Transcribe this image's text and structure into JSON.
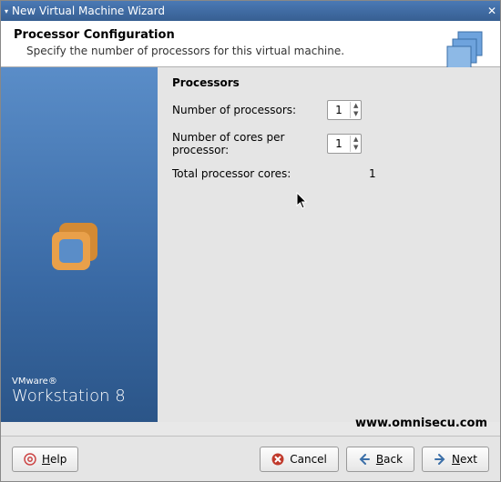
{
  "titlebar": {
    "text": "New Virtual Machine Wizard"
  },
  "header": {
    "title": "Processor Configuration",
    "subtitle": "Specify the number of processors for this virtual machine."
  },
  "sidebar": {
    "brand_small": "VMware®",
    "brand_big": "Workstation 8"
  },
  "processors": {
    "section": "Processors",
    "num_label": "Number of processors:",
    "num_value": "1",
    "cores_label": "Number of cores per processor:",
    "cores_value": "1",
    "total_label": "Total processor cores:",
    "total_value": "1"
  },
  "footer": {
    "url": "www.omnisecu.com"
  },
  "buttons": {
    "help": "Help",
    "cancel": "Cancel",
    "back": "Back",
    "next": "Next"
  }
}
